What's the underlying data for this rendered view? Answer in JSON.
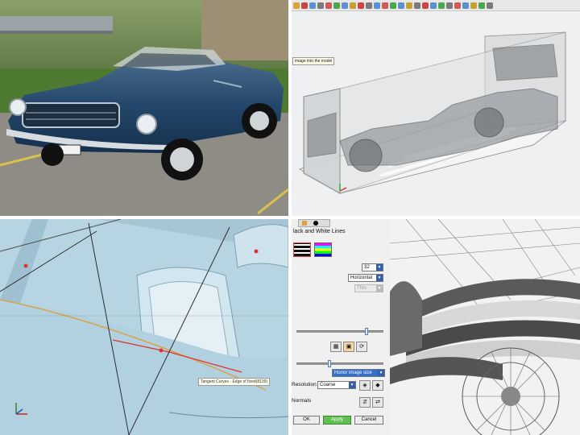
{
  "toolbar": {
    "tooltip": "image into the model"
  },
  "viewport": {
    "tooltip": "Tangent Curves - Edge of fixed(8139)"
  },
  "panel": {
    "header": "lack and White Lines",
    "lines_value": "32",
    "orientation_value": "Horizontal",
    "disabled_value": "Thin",
    "image_size_value": "Honor image size",
    "resolution_label": "Resolution",
    "resolution_value": "Coarse",
    "normals_label": "Normals",
    "ok_label": "OK",
    "apply_label": "Apply",
    "cancel_label": "Cancel"
  },
  "colors": {
    "car_body": "#1e3d5c",
    "surface_blue": "#bcd7e5",
    "apply_green": "#5fbf4f",
    "select_blue": "#2f6fd0"
  }
}
